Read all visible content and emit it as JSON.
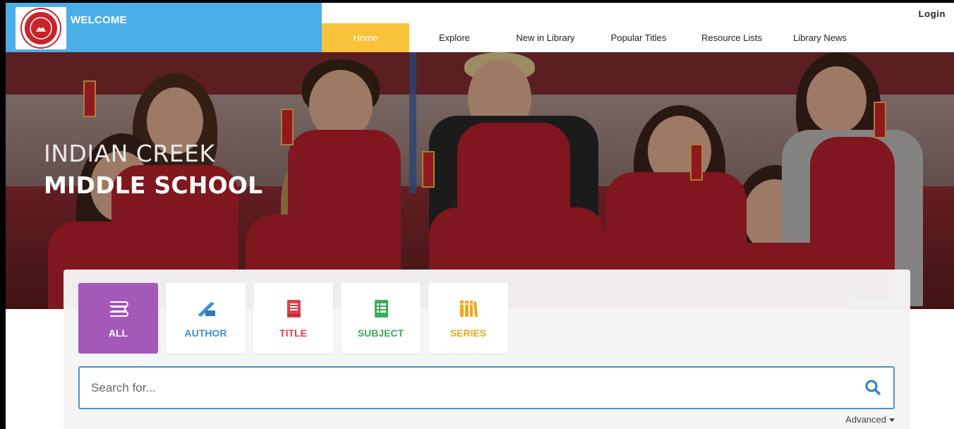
{
  "header": {
    "welcome": "WELCOME",
    "login": "Login",
    "logo_icon": "school-seal-icon",
    "brand_color": "#4aaee8"
  },
  "nav": {
    "items": [
      {
        "label": "Home",
        "active": true
      },
      {
        "label": "Explore",
        "active": false
      },
      {
        "label": "New in Library",
        "active": false
      },
      {
        "label": "Popular Titles",
        "active": false
      },
      {
        "label": "Resource Lists",
        "active": false
      },
      {
        "label": "Library News",
        "active": false
      }
    ],
    "active_color": "#f8c33a"
  },
  "hero": {
    "line1": "INDIAN CREEK",
    "line2": "MIDDLE SCHOOL"
  },
  "search": {
    "tabs": [
      {
        "label": "ALL",
        "icon": "books-stack-icon",
        "color": "#a458b8",
        "selected": true
      },
      {
        "label": "AUTHOR",
        "icon": "quill-pen-icon",
        "color": "#3f8fd0",
        "selected": false
      },
      {
        "label": "TITLE",
        "icon": "book-icon",
        "color": "#e0404b",
        "selected": false
      },
      {
        "label": "SUBJECT",
        "icon": "list-icon",
        "color": "#3cab5a",
        "selected": false
      },
      {
        "label": "SERIES",
        "icon": "book-series-icon",
        "color": "#f2a81c",
        "selected": false
      }
    ],
    "placeholder": "Search for...",
    "value": "",
    "advanced": "Advanced",
    "accent": "#4a93c9"
  }
}
